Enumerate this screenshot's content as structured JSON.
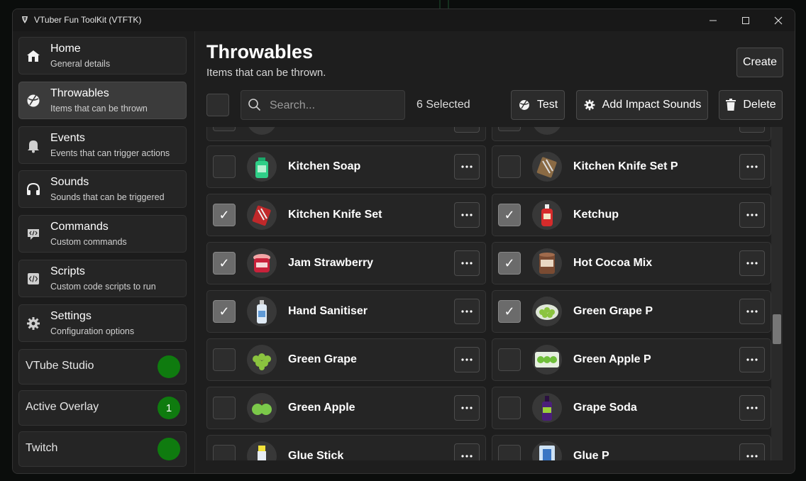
{
  "window": {
    "title": "VTuber Fun ToolKit (VTFTK)"
  },
  "sidebar": {
    "items": [
      {
        "title": "Home",
        "subtitle": "General details",
        "icon": "home-icon"
      },
      {
        "title": "Throwables",
        "subtitle": "Items that can be thrown",
        "icon": "throwable-ball-icon",
        "active": true
      },
      {
        "title": "Events",
        "subtitle": "Events that can trigger actions",
        "icon": "bell-icon"
      },
      {
        "title": "Sounds",
        "subtitle": "Sounds that can be triggered",
        "icon": "headphones-icon"
      },
      {
        "title": "Commands",
        "subtitle": "Custom commands",
        "icon": "code-chat-icon"
      },
      {
        "title": "Scripts",
        "subtitle": "Custom code scripts to run",
        "icon": "code-file-icon"
      },
      {
        "title": "Settings",
        "subtitle": "Configuration options",
        "icon": "gear-icon"
      }
    ],
    "status": [
      {
        "label": "VTube Studio",
        "badge": "",
        "color": "#0f7b0f"
      },
      {
        "label": "Active Overlay",
        "badge": "1",
        "color": "#0f7b0f"
      },
      {
        "label": "Twitch",
        "badge": "",
        "color": "#0f7b0f"
      }
    ]
  },
  "main": {
    "title": "Throwables",
    "subtitle": "Items that can be thrown.",
    "create_label": "Create",
    "search_placeholder": "Search...",
    "selected_text": "6 Selected",
    "test_label": "Test",
    "impact_label": "Add Impact Sounds",
    "delete_label": "Delete",
    "items": [
      {
        "name": "",
        "checked": false
      },
      {
        "name": "",
        "checked": false
      },
      {
        "name": "Kitchen Soap",
        "checked": false
      },
      {
        "name": "Kitchen Knife Set P",
        "checked": false
      },
      {
        "name": "Kitchen Knife Set",
        "checked": true
      },
      {
        "name": "Ketchup",
        "checked": true
      },
      {
        "name": "Jam Strawberry",
        "checked": true
      },
      {
        "name": "Hot Cocoa Mix",
        "checked": true
      },
      {
        "name": "Hand Sanitiser",
        "checked": true
      },
      {
        "name": "Green Grape P",
        "checked": true
      },
      {
        "name": "Green Grape",
        "checked": false
      },
      {
        "name": "Green Apple P",
        "checked": false
      },
      {
        "name": "Green Apple",
        "checked": false
      },
      {
        "name": "Grape Soda",
        "checked": false
      },
      {
        "name": "Glue Stick",
        "checked": false
      },
      {
        "name": "Glue P",
        "checked": false
      }
    ]
  },
  "colors": {
    "accent_green": "#0f7b0f",
    "checked_box": "#6b6b6b"
  }
}
